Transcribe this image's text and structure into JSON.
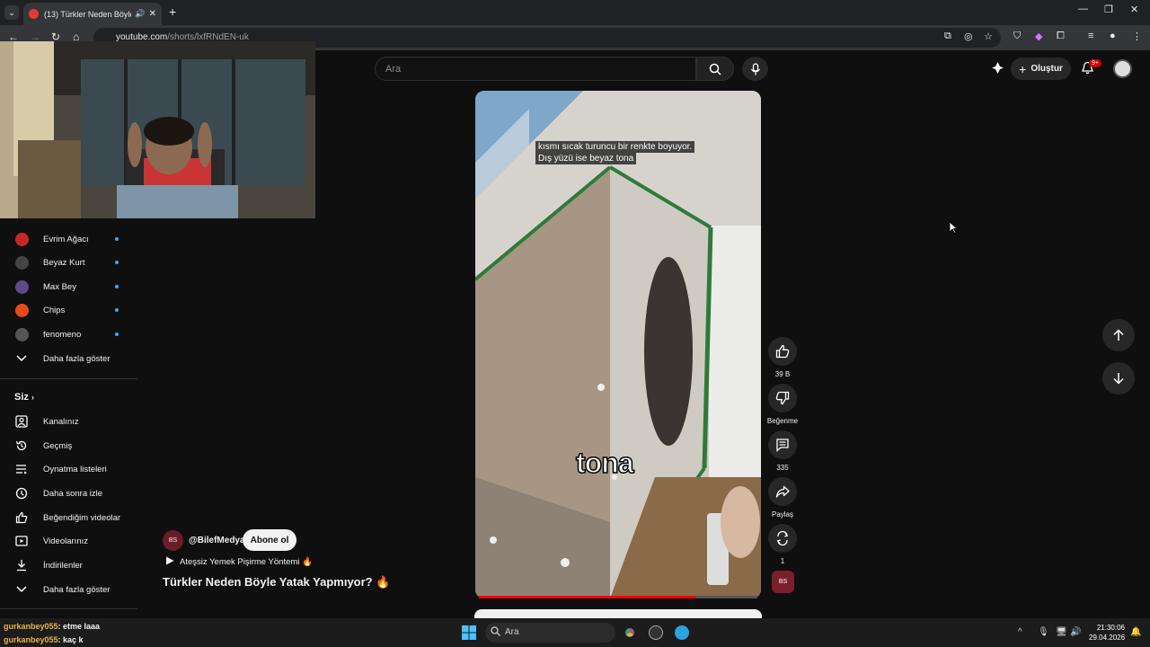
{
  "browser": {
    "tab_title": "(13) Türkler Neden Böyle Ya",
    "url_host": "youtube.com",
    "url_path": "/shorts/lxfRNdEN-uk"
  },
  "header": {
    "search_placeholder": "Ara",
    "create_label": "Oluştur",
    "notifications_badge": "9+"
  },
  "sidebar": {
    "subscriptions": [
      {
        "label": "Evrim Ağacı",
        "color": "#c62828"
      },
      {
        "label": "Beyaz Kurt",
        "color": "#444"
      },
      {
        "label": "Max Bey",
        "color": "#5c4a8a"
      },
      {
        "label": "Chips",
        "color": "#e64a19"
      },
      {
        "label": "fenomeno",
        "color": "#555"
      }
    ],
    "show_more_1": "Daha fazla göster",
    "section_you": "Siz",
    "you_items": [
      {
        "label": "Kanalınız",
        "icon": "user-icon"
      },
      {
        "label": "Geçmiş",
        "icon": "history-icon"
      },
      {
        "label": "Oynatma listeleri",
        "icon": "playlist-icon"
      },
      {
        "label": "Daha sonra izle",
        "icon": "clock-icon"
      },
      {
        "label": "Beğendiğim videolar",
        "icon": "thumbs-up-icon"
      },
      {
        "label": "Videolarınız",
        "icon": "video-icon"
      },
      {
        "label": "İndirilenler",
        "icon": "download-icon"
      }
    ],
    "show_more_2": "Daha fazla göster"
  },
  "short": {
    "caption_line1": "kısmı sıcak turuncu bir renkte boyuyor.",
    "caption_line2": "Dış yüzü ise beyaz tona",
    "big_caption": "tona",
    "progress": 0.78,
    "likes": "39 B",
    "dislike_label": "Beğenme",
    "comments": "335",
    "share_label": "Paylaş",
    "remix_count": "1",
    "channel": "@BilefMedya",
    "channel_avatar_text": "BS",
    "subscribe_label": "Abone ol",
    "playlist": "Ateşsiz Yemek Pişirme Yöntemi 🔥",
    "title": "Türkler Neden Böyle Yatak Yapmıyor? 🔥"
  },
  "chat": [
    {
      "user": "gurkanbey055",
      "msg": ": etme laaa"
    },
    {
      "user": "gurkanbey055",
      "msg": ": kaç k"
    }
  ],
  "taskbar": {
    "search_placeholder": "Ara",
    "time": "21:30:06",
    "date": "29.04.2026"
  }
}
